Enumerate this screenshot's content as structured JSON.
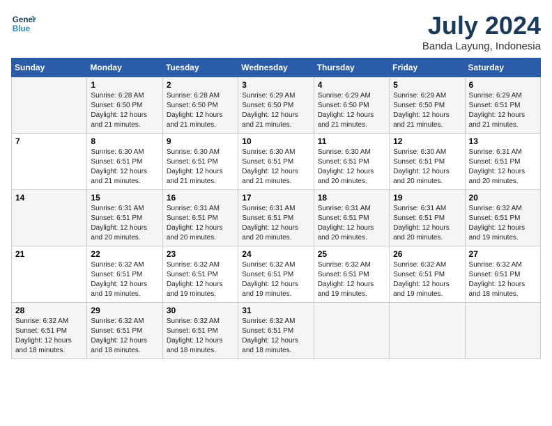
{
  "logo": {
    "line1": "General",
    "line2": "Blue"
  },
  "title": "July 2024",
  "location": "Banda Layung, Indonesia",
  "days_header": [
    "Sunday",
    "Monday",
    "Tuesday",
    "Wednesday",
    "Thursday",
    "Friday",
    "Saturday"
  ],
  "weeks": [
    [
      {
        "day": "",
        "info": ""
      },
      {
        "day": "1",
        "info": "Sunrise: 6:28 AM\nSunset: 6:50 PM\nDaylight: 12 hours\nand 21 minutes."
      },
      {
        "day": "2",
        "info": "Sunrise: 6:28 AM\nSunset: 6:50 PM\nDaylight: 12 hours\nand 21 minutes."
      },
      {
        "day": "3",
        "info": "Sunrise: 6:29 AM\nSunset: 6:50 PM\nDaylight: 12 hours\nand 21 minutes."
      },
      {
        "day": "4",
        "info": "Sunrise: 6:29 AM\nSunset: 6:50 PM\nDaylight: 12 hours\nand 21 minutes."
      },
      {
        "day": "5",
        "info": "Sunrise: 6:29 AM\nSunset: 6:50 PM\nDaylight: 12 hours\nand 21 minutes."
      },
      {
        "day": "6",
        "info": "Sunrise: 6:29 AM\nSunset: 6:51 PM\nDaylight: 12 hours\nand 21 minutes."
      }
    ],
    [
      {
        "day": "7",
        "info": ""
      },
      {
        "day": "8",
        "info": "Sunrise: 6:30 AM\nSunset: 6:51 PM\nDaylight: 12 hours\nand 21 minutes."
      },
      {
        "day": "9",
        "info": "Sunrise: 6:30 AM\nSunset: 6:51 PM\nDaylight: 12 hours\nand 21 minutes."
      },
      {
        "day": "10",
        "info": "Sunrise: 6:30 AM\nSunset: 6:51 PM\nDaylight: 12 hours\nand 21 minutes."
      },
      {
        "day": "11",
        "info": "Sunrise: 6:30 AM\nSunset: 6:51 PM\nDaylight: 12 hours\nand 20 minutes."
      },
      {
        "day": "12",
        "info": "Sunrise: 6:30 AM\nSunset: 6:51 PM\nDaylight: 12 hours\nand 20 minutes."
      },
      {
        "day": "13",
        "info": "Sunrise: 6:31 AM\nSunset: 6:51 PM\nDaylight: 12 hours\nand 20 minutes."
      }
    ],
    [
      {
        "day": "14",
        "info": ""
      },
      {
        "day": "15",
        "info": "Sunrise: 6:31 AM\nSunset: 6:51 PM\nDaylight: 12 hours\nand 20 minutes."
      },
      {
        "day": "16",
        "info": "Sunrise: 6:31 AM\nSunset: 6:51 PM\nDaylight: 12 hours\nand 20 minutes."
      },
      {
        "day": "17",
        "info": "Sunrise: 6:31 AM\nSunset: 6:51 PM\nDaylight: 12 hours\nand 20 minutes."
      },
      {
        "day": "18",
        "info": "Sunrise: 6:31 AM\nSunset: 6:51 PM\nDaylight: 12 hours\nand 20 minutes."
      },
      {
        "day": "19",
        "info": "Sunrise: 6:31 AM\nSunset: 6:51 PM\nDaylight: 12 hours\nand 20 minutes."
      },
      {
        "day": "20",
        "info": "Sunrise: 6:32 AM\nSunset: 6:51 PM\nDaylight: 12 hours\nand 19 minutes."
      }
    ],
    [
      {
        "day": "21",
        "info": ""
      },
      {
        "day": "22",
        "info": "Sunrise: 6:32 AM\nSunset: 6:51 PM\nDaylight: 12 hours\nand 19 minutes."
      },
      {
        "day": "23",
        "info": "Sunrise: 6:32 AM\nSunset: 6:51 PM\nDaylight: 12 hours\nand 19 minutes."
      },
      {
        "day": "24",
        "info": "Sunrise: 6:32 AM\nSunset: 6:51 PM\nDaylight: 12 hours\nand 19 minutes."
      },
      {
        "day": "25",
        "info": "Sunrise: 6:32 AM\nSunset: 6:51 PM\nDaylight: 12 hours\nand 19 minutes."
      },
      {
        "day": "26",
        "info": "Sunrise: 6:32 AM\nSunset: 6:51 PM\nDaylight: 12 hours\nand 19 minutes."
      },
      {
        "day": "27",
        "info": "Sunrise: 6:32 AM\nSunset: 6:51 PM\nDaylight: 12 hours\nand 18 minutes."
      }
    ],
    [
      {
        "day": "28",
        "info": "Sunrise: 6:32 AM\nSunset: 6:51 PM\nDaylight: 12 hours\nand 18 minutes."
      },
      {
        "day": "29",
        "info": "Sunrise: 6:32 AM\nSunset: 6:51 PM\nDaylight: 12 hours\nand 18 minutes."
      },
      {
        "day": "30",
        "info": "Sunrise: 6:32 AM\nSunset: 6:51 PM\nDaylight: 12 hours\nand 18 minutes."
      },
      {
        "day": "31",
        "info": "Sunrise: 6:32 AM\nSunset: 6:51 PM\nDaylight: 12 hours\nand 18 minutes."
      },
      {
        "day": "",
        "info": ""
      },
      {
        "day": "",
        "info": ""
      },
      {
        "day": "",
        "info": ""
      }
    ]
  ]
}
